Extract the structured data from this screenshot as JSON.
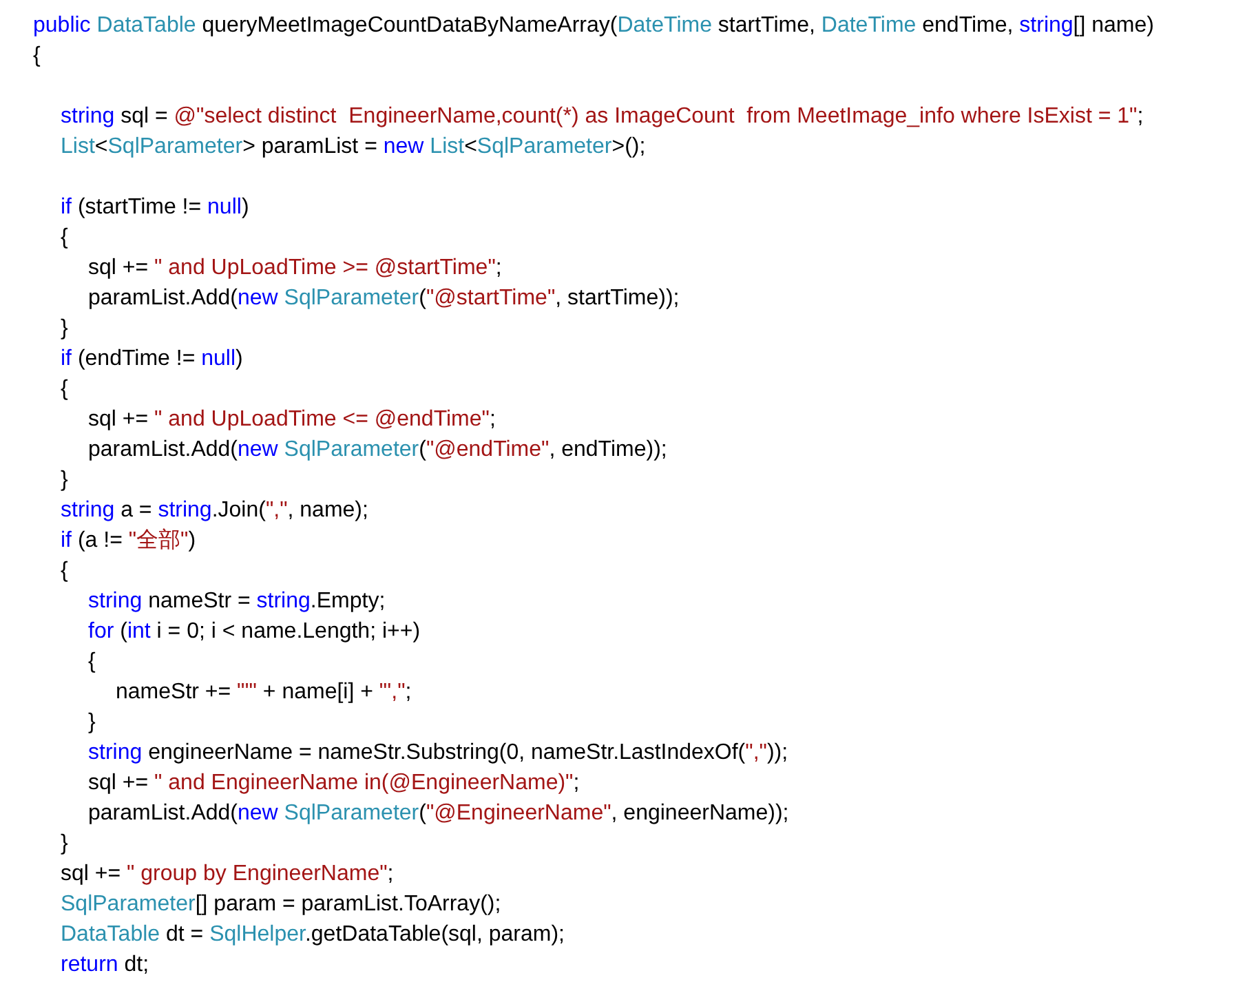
{
  "code": {
    "lines": [
      {
        "kind": "code",
        "tokens": [
          {
            "kind": "kw",
            "text": "public"
          },
          {
            "kind": "type",
            "text": " DataTable"
          },
          {
            "kind": "plain",
            "text": " queryMeetImageCountDataByNameArray("
          },
          {
            "kind": "type",
            "text": "DateTime"
          },
          {
            "kind": "plain",
            "text": " startTime, "
          },
          {
            "kind": "type",
            "text": "DateTime"
          },
          {
            "kind": "plain",
            "text": " endTime, "
          },
          {
            "kind": "kw",
            "text": "string"
          },
          {
            "kind": "plain",
            "text": "[] name)"
          }
        ]
      },
      {
        "kind": "code",
        "tokens": [
          {
            "kind": "plain",
            "text": "{"
          }
        ],
        "children": [
          {
            "kind": "blank"
          },
          {
            "kind": "code",
            "tokens": [
              {
                "kind": "kw",
                "text": "string"
              },
              {
                "kind": "plain",
                "text": " sql = "
              },
              {
                "kind": "str",
                "text": "@\"select distinct  EngineerName,count(*) as ImageCount  from MeetImage_info where IsExist = 1\""
              },
              {
                "kind": "plain",
                "text": ";"
              }
            ]
          },
          {
            "kind": "code",
            "tokens": [
              {
                "kind": "type",
                "text": "List"
              },
              {
                "kind": "plain",
                "text": "<"
              },
              {
                "kind": "type",
                "text": "SqlParameter"
              },
              {
                "kind": "plain",
                "text": "> paramList = "
              },
              {
                "kind": "kw",
                "text": "new"
              },
              {
                "kind": "type",
                "text": " List"
              },
              {
                "kind": "plain",
                "text": "<"
              },
              {
                "kind": "type",
                "text": "SqlParameter"
              },
              {
                "kind": "plain",
                "text": ">();"
              }
            ]
          },
          {
            "kind": "blank"
          },
          {
            "kind": "code",
            "tokens": [
              {
                "kind": "kw",
                "text": "if"
              },
              {
                "kind": "plain",
                "text": " (startTime != "
              },
              {
                "kind": "kw",
                "text": "null"
              },
              {
                "kind": "plain",
                "text": ")"
              }
            ]
          },
          {
            "kind": "code",
            "tokens": [
              {
                "kind": "plain",
                "text": "{"
              }
            ],
            "children": [
              {
                "kind": "code",
                "tokens": [
                  {
                    "kind": "plain",
                    "text": "sql += "
                  },
                  {
                    "kind": "str",
                    "text": "\" and UpLoadTime >= @startTime\""
                  },
                  {
                    "kind": "plain",
                    "text": ";"
                  }
                ]
              },
              {
                "kind": "code",
                "tokens": [
                  {
                    "kind": "plain",
                    "text": "paramList.Add("
                  },
                  {
                    "kind": "kw",
                    "text": "new"
                  },
                  {
                    "kind": "type",
                    "text": " SqlParameter"
                  },
                  {
                    "kind": "plain",
                    "text": "("
                  },
                  {
                    "kind": "str",
                    "text": "\"@startTime\""
                  },
                  {
                    "kind": "plain",
                    "text": ", startTime));"
                  }
                ]
              }
            ]
          },
          {
            "kind": "code",
            "tokens": [
              {
                "kind": "plain",
                "text": "}"
              }
            ]
          },
          {
            "kind": "code",
            "tokens": [
              {
                "kind": "kw",
                "text": "if"
              },
              {
                "kind": "plain",
                "text": " (endTime != "
              },
              {
                "kind": "kw",
                "text": "null"
              },
              {
                "kind": "plain",
                "text": ")"
              }
            ]
          },
          {
            "kind": "code",
            "tokens": [
              {
                "kind": "plain",
                "text": "{"
              }
            ],
            "children": [
              {
                "kind": "code",
                "tokens": [
                  {
                    "kind": "plain",
                    "text": "sql += "
                  },
                  {
                    "kind": "str",
                    "text": "\" and UpLoadTime <= @endTime\""
                  },
                  {
                    "kind": "plain",
                    "text": ";"
                  }
                ]
              },
              {
                "kind": "code",
                "tokens": [
                  {
                    "kind": "plain",
                    "text": "paramList.Add("
                  },
                  {
                    "kind": "kw",
                    "text": "new"
                  },
                  {
                    "kind": "type",
                    "text": " SqlParameter"
                  },
                  {
                    "kind": "plain",
                    "text": "("
                  },
                  {
                    "kind": "str",
                    "text": "\"@endTime\""
                  },
                  {
                    "kind": "plain",
                    "text": ", endTime));"
                  }
                ]
              }
            ]
          },
          {
            "kind": "code",
            "tokens": [
              {
                "kind": "plain",
                "text": "}"
              }
            ]
          },
          {
            "kind": "code",
            "tokens": [
              {
                "kind": "kw",
                "text": "string"
              },
              {
                "kind": "plain",
                "text": " a = "
              },
              {
                "kind": "kw",
                "text": "string"
              },
              {
                "kind": "plain",
                "text": ".Join("
              },
              {
                "kind": "str",
                "text": "\",\""
              },
              {
                "kind": "plain",
                "text": ", name);"
              }
            ]
          },
          {
            "kind": "code",
            "tokens": [
              {
                "kind": "kw",
                "text": "if"
              },
              {
                "kind": "plain",
                "text": " (a != "
              },
              {
                "kind": "str",
                "text": "\"全部\""
              },
              {
                "kind": "plain",
                "text": ")"
              }
            ]
          },
          {
            "kind": "code",
            "tokens": [
              {
                "kind": "plain",
                "text": "{"
              }
            ],
            "children": [
              {
                "kind": "code",
                "tokens": [
                  {
                    "kind": "kw",
                    "text": "string"
                  },
                  {
                    "kind": "plain",
                    "text": " nameStr = "
                  },
                  {
                    "kind": "kw",
                    "text": "string"
                  },
                  {
                    "kind": "plain",
                    "text": ".Empty;"
                  }
                ]
              },
              {
                "kind": "code",
                "tokens": [
                  {
                    "kind": "kw",
                    "text": "for"
                  },
                  {
                    "kind": "plain",
                    "text": " ("
                  },
                  {
                    "kind": "kw",
                    "text": "int"
                  },
                  {
                    "kind": "plain",
                    "text": " i = 0; i < name.Length; i++)"
                  }
                ]
              },
              {
                "kind": "code",
                "tokens": [
                  {
                    "kind": "plain",
                    "text": "{"
                  }
                ],
                "children": [
                  {
                    "kind": "code",
                    "tokens": [
                      {
                        "kind": "plain",
                        "text": "nameStr += "
                      },
                      {
                        "kind": "str",
                        "text": "\"'\""
                      },
                      {
                        "kind": "plain",
                        "text": " + name[i] + "
                      },
                      {
                        "kind": "str",
                        "text": "\"',\""
                      },
                      {
                        "kind": "plain",
                        "text": ";"
                      }
                    ]
                  }
                ]
              },
              {
                "kind": "code",
                "tokens": [
                  {
                    "kind": "plain",
                    "text": "}"
                  }
                ]
              },
              {
                "kind": "code",
                "tokens": [
                  {
                    "kind": "kw",
                    "text": "string"
                  },
                  {
                    "kind": "plain",
                    "text": " engineerName = nameStr.Substring(0, nameStr.LastIndexOf("
                  },
                  {
                    "kind": "str",
                    "text": "\",\""
                  },
                  {
                    "kind": "plain",
                    "text": "));"
                  }
                ]
              },
              {
                "kind": "code",
                "tokens": [
                  {
                    "kind": "plain",
                    "text": "sql += "
                  },
                  {
                    "kind": "str",
                    "text": "\" and EngineerName in(@EngineerName)\""
                  },
                  {
                    "kind": "plain",
                    "text": ";"
                  }
                ]
              },
              {
                "kind": "code",
                "tokens": [
                  {
                    "kind": "plain",
                    "text": "paramList.Add("
                  },
                  {
                    "kind": "kw",
                    "text": "new"
                  },
                  {
                    "kind": "type",
                    "text": " SqlParameter"
                  },
                  {
                    "kind": "plain",
                    "text": "("
                  },
                  {
                    "kind": "str",
                    "text": "\"@EngineerName\""
                  },
                  {
                    "kind": "plain",
                    "text": ", engineerName));"
                  }
                ]
              }
            ]
          },
          {
            "kind": "code",
            "tokens": [
              {
                "kind": "plain",
                "text": "}"
              }
            ]
          },
          {
            "kind": "code",
            "tokens": [
              {
                "kind": "plain",
                "text": "sql += "
              },
              {
                "kind": "str",
                "text": "\" group by EngineerName\""
              },
              {
                "kind": "plain",
                "text": ";"
              }
            ]
          },
          {
            "kind": "code",
            "tokens": [
              {
                "kind": "type",
                "text": "SqlParameter"
              },
              {
                "kind": "plain",
                "text": "[] param = paramList.ToArray();"
              }
            ]
          },
          {
            "kind": "code",
            "tokens": [
              {
                "kind": "type",
                "text": "DataTable"
              },
              {
                "kind": "plain",
                "text": " dt = "
              },
              {
                "kind": "type",
                "text": "SqlHelper"
              },
              {
                "kind": "plain",
                "text": ".getDataTable(sql, param);"
              }
            ]
          },
          {
            "kind": "code",
            "tokens": [
              {
                "kind": "kw",
                "text": "return"
              },
              {
                "kind": "plain",
                "text": " dt;"
              }
            ]
          }
        ]
      }
    ]
  }
}
